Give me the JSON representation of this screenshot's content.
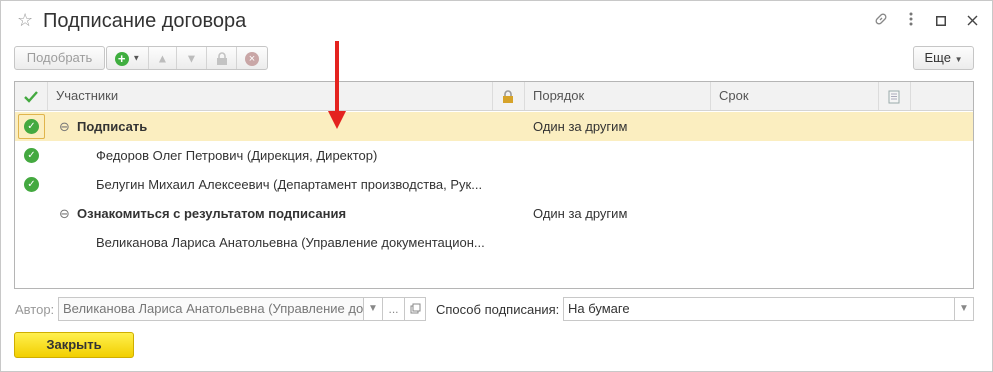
{
  "window": {
    "title": "Подписание договора"
  },
  "icons": {
    "favorite": "star-icon",
    "link": "link-icon",
    "menu": "more-vert-icon",
    "maximize": "maximize-icon",
    "close": "close-icon"
  },
  "toolbar": {
    "pick_label": "Подобрать",
    "more_label": "Еще"
  },
  "table": {
    "columns": [
      "Участники",
      "Порядок",
      "Срок"
    ],
    "rows": [
      {
        "name": "Подписать",
        "order": "Один за другим",
        "level": 0,
        "bold": true,
        "checked": true,
        "selected": true
      },
      {
        "name": "Федоров Олег Петрович (Дирекция, Директор)",
        "order": "",
        "level": 1,
        "bold": false,
        "checked": true,
        "selected": false
      },
      {
        "name": "Белугин Михаил Алексеевич (Департамент производства, Рук...",
        "order": "",
        "level": 1,
        "bold": false,
        "checked": true,
        "selected": false
      },
      {
        "name": "Ознакомиться с результатом подписания",
        "order": "Один за другим",
        "level": 0,
        "bold": true,
        "checked": false,
        "selected": false
      },
      {
        "name": "Великанова Лариса Анатольевна (Управление документацион...",
        "order": "",
        "level": 1,
        "bold": false,
        "checked": false,
        "selected": false
      }
    ]
  },
  "form": {
    "author_label": "Автор:",
    "author_value": "Великанова Лариса Анатольевна (Управление до",
    "author_dots": "...",
    "method_label": "Способ подписания:",
    "method_value": "На бумаге"
  },
  "footer": {
    "close_label": "Закрыть"
  },
  "colors": {
    "accent_yellow": "#f2cf00",
    "selected_row": "#fbeec0",
    "check_green": "#44a940",
    "arrow_red": "#e4231f"
  }
}
